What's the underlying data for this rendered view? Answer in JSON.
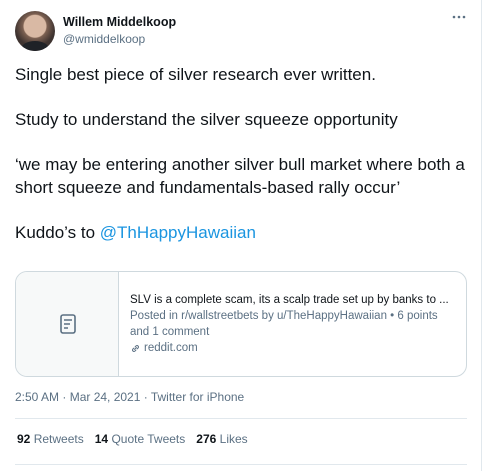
{
  "user": {
    "name": "Willem Middelkoop",
    "handle": "@wmiddelkoop"
  },
  "more_icon": "more-horizontal-icon",
  "tweet": {
    "line1": "Single best piece of silver research ever written.",
    "line2": "Study to understand the silver squeeze opportunity",
    "line3": "‘we may be entering another silver bull market where both a short squeeze and fundamentals-based rally occur’",
    "line4_prefix": "Kuddo’s to ",
    "mention": "@ThHappyHawaiian"
  },
  "link_card": {
    "title": "SLV is a complete scam, its a scalp trade set up by banks to ...",
    "description": "Posted in r/wallstreetbets by u/TheHappyHawaiian • 6 points and 1 comment",
    "domain": "reddit.com",
    "thumb_icon": "document-icon"
  },
  "meta": {
    "timestamp": "2:50 AM · Mar 24, 2021 · Twitter for iPhone"
  },
  "stats": {
    "retweets_count": "92",
    "retweets_label": "Retweets",
    "quotes_count": "14",
    "quotes_label": "Quote Tweets",
    "likes_count": "276",
    "likes_label": "Likes"
  },
  "colors": {
    "mention": "#1b95e0",
    "secondary": "#5b7083",
    "border": "#cfd9de"
  }
}
